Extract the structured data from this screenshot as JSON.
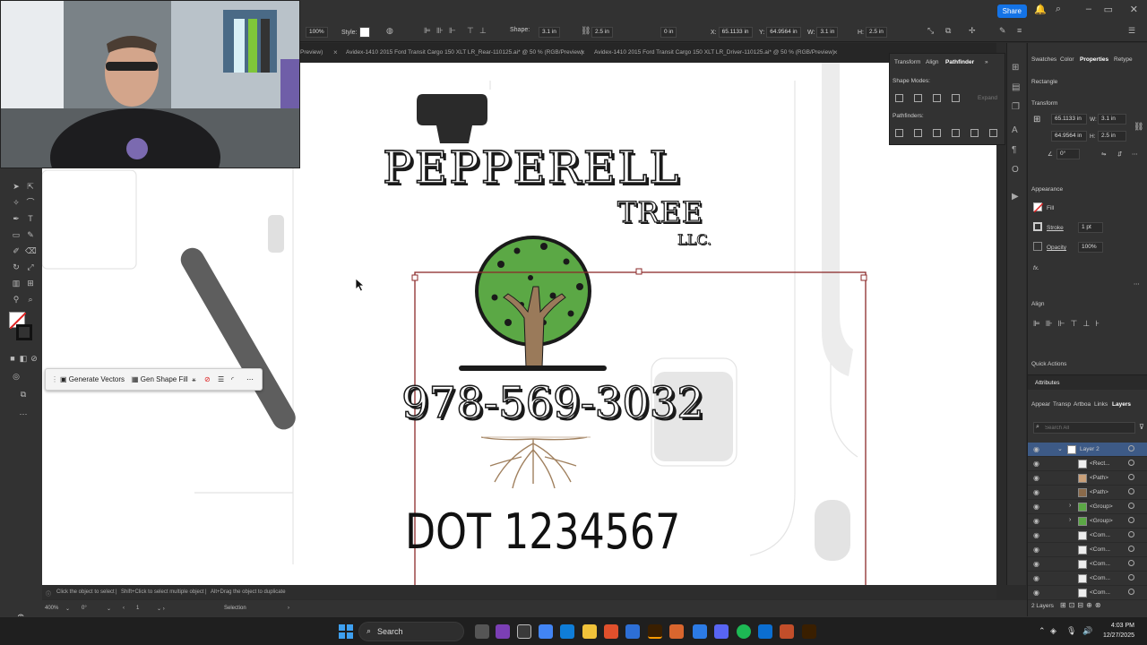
{
  "window": {
    "share_label": "Share"
  },
  "controlbar": {
    "zoom": "100%",
    "style_label": "Style:",
    "shape_label": "Shape:",
    "shape_w": "3.1 in",
    "shape_h": "2.5 in",
    "corner": "0 in",
    "x_label": "X:",
    "x": "65.1133 in",
    "y_label": "Y:",
    "y": "64.9564 in",
    "w_label": "W:",
    "w": "3.1 in",
    "h_label": "H:",
    "h": "2.5 in"
  },
  "tabs": [
    {
      "label": "Preview)"
    },
    {
      "label": "Avidex-1410 2015 Ford Transit Cargo 150 XLT LR_Rear-110125.ai* @ 50 % (RGB/Preview)"
    },
    {
      "label": "Avidex-1410 2015 Ford Transit Cargo 150 XLT LR_Driver-110125.ai* @ 50 % (RGB/Preview)"
    }
  ],
  "artwork": {
    "title": "PEPPERELL",
    "subtitle": "TREE",
    "suffix": "LLC.",
    "phone": "978-569-3032",
    "dot": "DOT 1234567"
  },
  "context_bar": {
    "generate": "Generate Vectors",
    "gen_fill": "Gen Shape Fill"
  },
  "pathfinder": {
    "tabs": [
      "Transform",
      "Align",
      "Pathfinder"
    ],
    "shape_modes": "Shape Modes:",
    "expand": "Expand",
    "pathfinders": "Pathfinders:"
  },
  "properties": {
    "tabs": [
      "Swatches",
      "Color",
      "Properties",
      "Retype"
    ],
    "object": "Rectangle",
    "transform": "Transform",
    "x": "65.1133 in",
    "y": "64.9564 in",
    "w": "3.1 in",
    "h": "2.5 in",
    "angle": "0°",
    "appearance": "Appearance",
    "fill": "Fill",
    "stroke": "Stroke",
    "stroke_w": "1 pt",
    "opacity": "Opacity",
    "opacity_v": "100%",
    "fx": "fx.",
    "align": "Align",
    "quick_actions": "Quick Actions",
    "attributes": "Attributes"
  },
  "layers": {
    "tabs": [
      "Appear",
      "Transp",
      "Artboa",
      "Links",
      "Layers"
    ],
    "search_placeholder": "Search All",
    "rows": [
      "Layer 2",
      "<Rect...",
      "<Path>",
      "<Path>",
      "<Group>",
      "<Group>",
      "<Com...",
      "<Com...",
      "<Com...",
      "<Com...",
      "<Com..."
    ],
    "footer": "2 Layers"
  },
  "status": {
    "hint1": "Click the object to select",
    "hint2": "Shift+Click to select multiple object",
    "hint3": "Alt+Drag the object to duplicate",
    "zoom": "400%",
    "angle": "0°",
    "artboard": "1",
    "tool": "Selection"
  },
  "taskbar": {
    "search": "Search",
    "time": "4:03 PM",
    "date": "12/27/2025"
  },
  "colors": {
    "accent": "#1473e6",
    "artboard_stroke": "#8b2a2a",
    "leaf": "#5ba845",
    "trunk": "#9a7a5a"
  }
}
